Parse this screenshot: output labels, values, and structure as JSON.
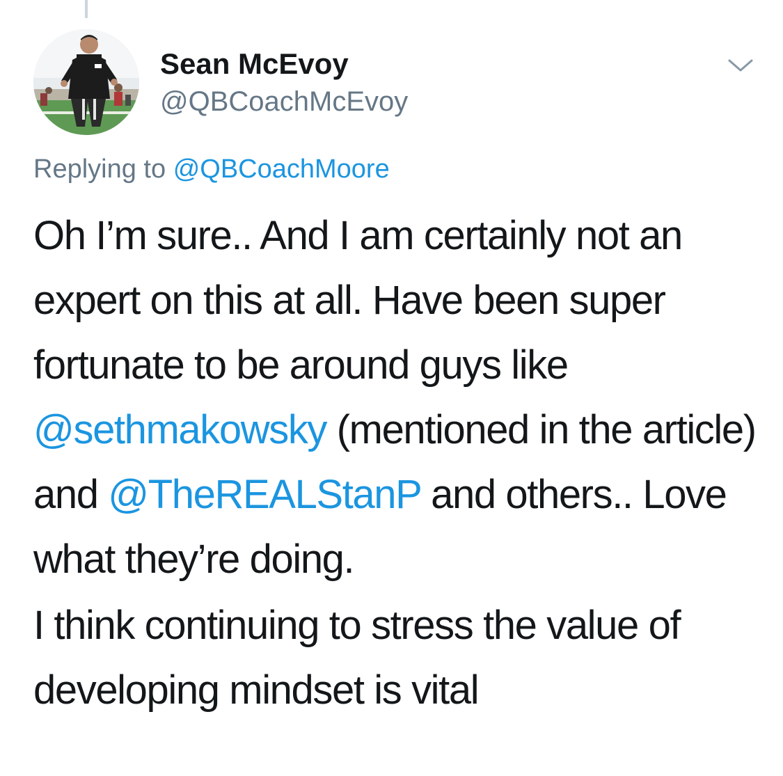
{
  "author": {
    "display_name": "Sean McEvoy",
    "handle": "@QBCoachMcEvoy"
  },
  "reply_context": {
    "prefix": "Replying to",
    "target_handle": "@QBCoachMoore"
  },
  "tweet": {
    "paragraph1": {
      "text_a": "Oh I’m sure.. And I am certainly not an expert on this at all. Have been super fortunate to be around guys like ",
      "mention_a": "@sethmakowsky",
      "text_b": " (mentioned in the article) and ",
      "mention_b": "@TheREALStanP",
      "text_c": " and others.. Love what they’re doing."
    },
    "paragraph2": "I think continuing to stress the value of developing mindset is vital"
  },
  "icons": {
    "menu_caret": "chevron-down-icon",
    "avatar": "profile-photo"
  },
  "colors": {
    "link": "#1b95e0",
    "secondary_text": "#657786",
    "primary_text": "#14171a",
    "thread_line": "#ccd6dd"
  }
}
